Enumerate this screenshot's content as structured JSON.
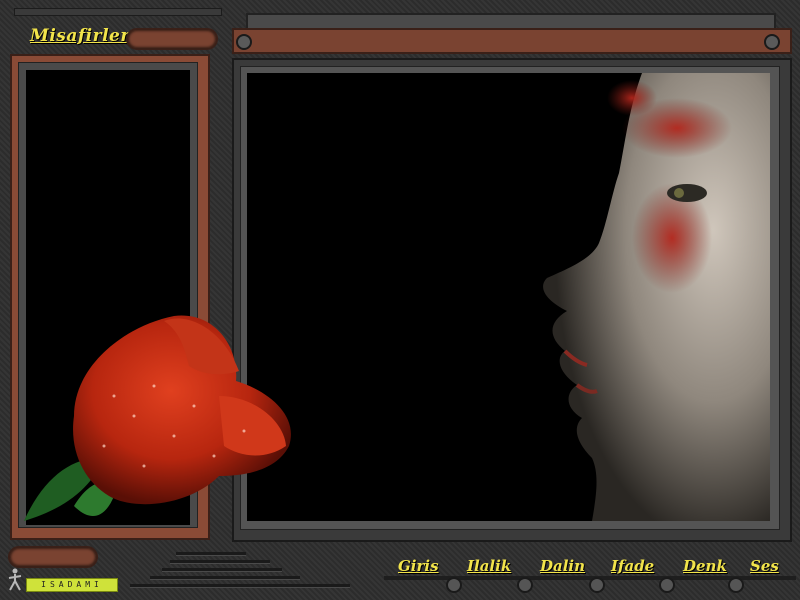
{
  "title": "Misafirler",
  "nav": {
    "items": [
      "Giris",
      "Ilalik",
      "Dalin",
      "Ifade",
      "Denk",
      "Ses"
    ]
  },
  "logo": {
    "text": "ISADAMI",
    "icon": "stick-figure-icon"
  },
  "colors": {
    "accent_text": "#f2e44a",
    "rust": "#7a4331",
    "frame": "#3a3a3a",
    "logo_badge": "#cfe23a"
  },
  "images": {
    "rose": "red-rose-icon",
    "face": "face-profile-image"
  }
}
